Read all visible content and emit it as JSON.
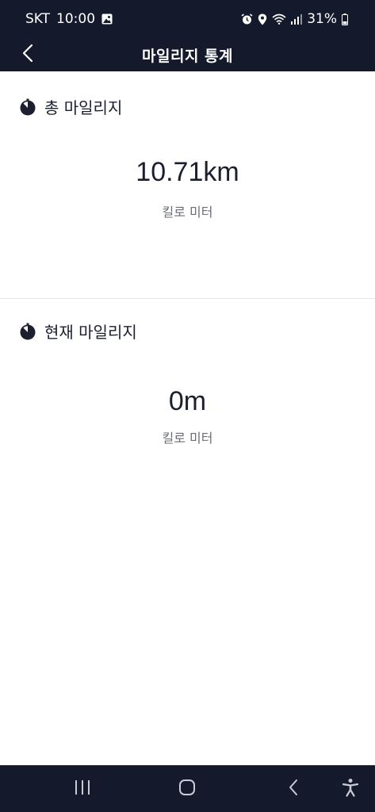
{
  "status_bar": {
    "carrier": "SKT",
    "time": "10:00",
    "battery": "31%"
  },
  "app_bar": {
    "title": "마일리지 통계"
  },
  "total_mileage": {
    "label": "총 마일리지",
    "value": "10.71km",
    "unit_label": "킬로 미터"
  },
  "current_mileage": {
    "label": "현재 마일리지",
    "value": "0m",
    "unit_label": "킬로 미터"
  },
  "icons": {
    "section_icon": "stopwatch-icon",
    "back": "chevron-left-icon",
    "nav": [
      "recents-icon",
      "home-icon",
      "back-icon",
      "accessibility-icon"
    ]
  },
  "colors": {
    "bar_background": "#141a2b",
    "text_primary": "#1b1f2e",
    "text_secondary": "#6b6d75"
  }
}
